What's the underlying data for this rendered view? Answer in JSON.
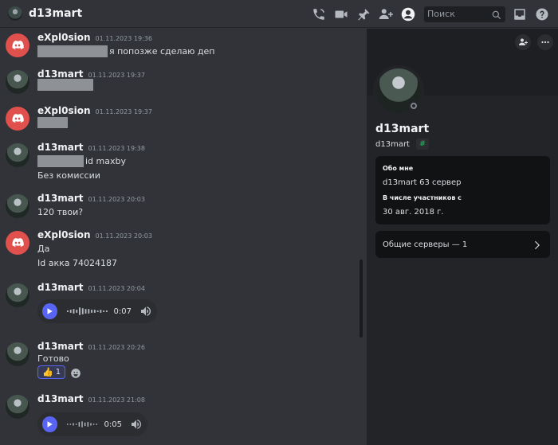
{
  "header": {
    "title": "d13mart",
    "search_placeholder": "Поиск"
  },
  "messages": [
    {
      "author": "eXpl0sion",
      "time": "01.11.2023 19:36",
      "lines": [
        "я попозже сделаю деп"
      ]
    },
    {
      "author": "d13mart",
      "time": "01.11.2023 19:37",
      "lines": []
    },
    {
      "author": "eXpl0sion",
      "time": "01.11.2023 19:37",
      "lines": []
    },
    {
      "author": "d13mart",
      "time": "01.11.2023 19:38",
      "lines": [
        "id maxby",
        "Без комиссии"
      ]
    },
    {
      "author": "d13mart",
      "time": "01.11.2023 20:03",
      "lines": [
        "120 твои?"
      ]
    },
    {
      "author": "eXpl0sion",
      "time": "01.11.2023 20:03",
      "lines": [
        "Да",
        "Id акка 74024187"
      ]
    },
    {
      "author": "d13mart",
      "time": "01.11.2023 20:04",
      "voice_duration": "0:07"
    },
    {
      "author": "d13mart",
      "time": "01.11.2023 20:26",
      "lines": [
        "Готово"
      ],
      "reaction": {
        "emoji": "👍",
        "count": "1"
      }
    },
    {
      "author": "d13mart",
      "time": "01.11.2023 21:08",
      "voice_duration": "0:05"
    }
  ],
  "profile": {
    "display_name": "d13mart",
    "username": "d13mart",
    "about_heading": "Обо мне",
    "about_text": "d13mart  63 сервер",
    "member_since_heading": "В числе участников с",
    "member_since": "30 авг. 2018 г.",
    "mutual_servers": "Общие серверы — 1",
    "status": "offline"
  },
  "colors": {
    "background": "#313338",
    "panel": "#232428",
    "card": "#111214",
    "accent": "#5865f2",
    "discord_red": "#e0504d"
  }
}
